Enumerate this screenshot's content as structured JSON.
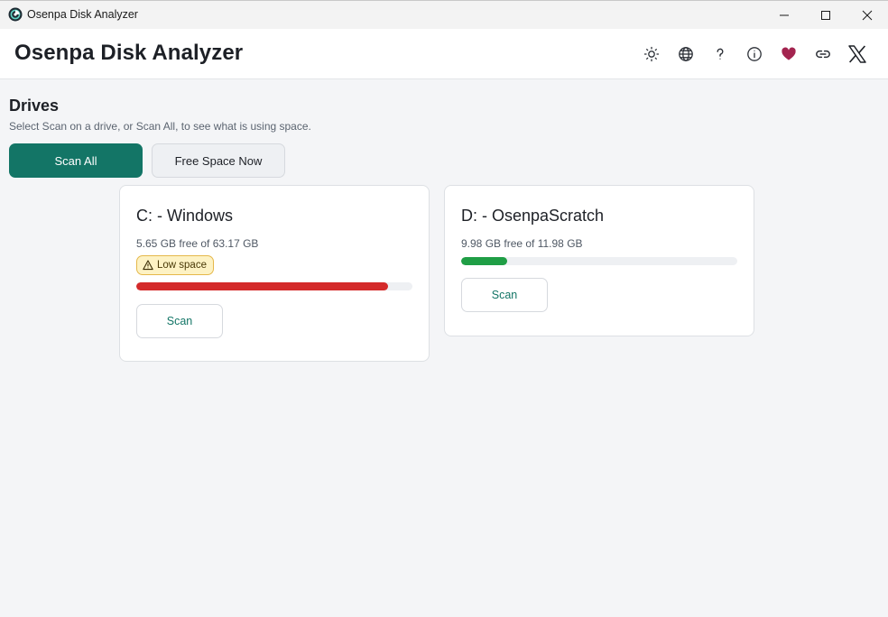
{
  "window": {
    "title": "Osenpa Disk Analyzer"
  },
  "header": {
    "title": "Osenpa Disk Analyzer",
    "icons": [
      "theme-icon",
      "language-icon",
      "help-icon",
      "info-icon",
      "heart-icon",
      "link-icon",
      "x-logo-icon"
    ]
  },
  "drives_section": {
    "title": "Drives",
    "subtitle": "Select Scan on a drive, or Scan All, to see what is using space.",
    "scan_all_label": "Scan All",
    "free_space_label": "Free Space Now"
  },
  "drives": [
    {
      "name": "C: - Windows",
      "free_text": "5.65 GB free of 63.17 GB",
      "badge": "Low space",
      "used_fraction": 0.911,
      "bar_color": "#d42a2a",
      "scan_label": "Scan"
    },
    {
      "name": "D: - OsenpaScratch",
      "free_text": "9.98 GB free of 11.98 GB",
      "used_fraction": 0.167,
      "bar_color": "#1f9e45",
      "scan_label": "Scan"
    }
  ],
  "colors": {
    "accent": "#137566",
    "heart": "#a3244f",
    "warning_bg": "#fdf2c4",
    "warning_border": "#e5b84a"
  }
}
